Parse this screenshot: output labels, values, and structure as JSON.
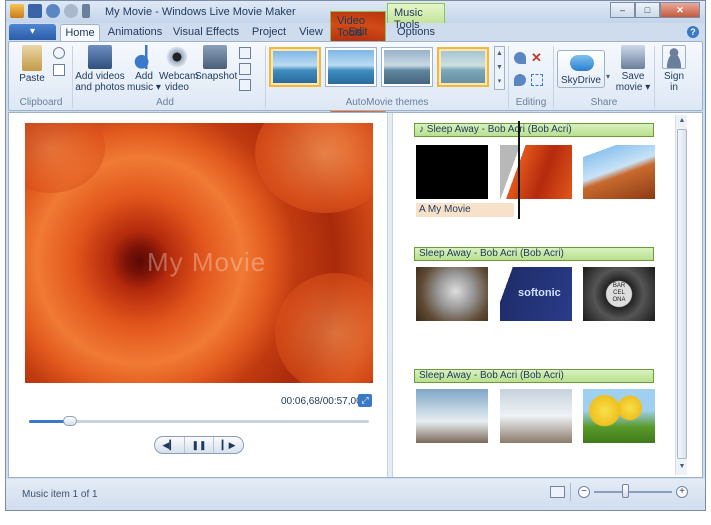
{
  "window": {
    "title": "My Movie - Windows Live Movie Maker",
    "context_tabs": {
      "video": "Video Tools",
      "music": "Music Tools"
    },
    "controls": {
      "minimize": "–",
      "maximize": "□",
      "close": "✕"
    }
  },
  "ribbon_tabs": [
    {
      "label": "Home"
    },
    {
      "label": "Animations"
    },
    {
      "label": "Visual Effects"
    },
    {
      "label": "Project"
    },
    {
      "label": "View"
    },
    {
      "label": "Edit"
    },
    {
      "label": "Options"
    }
  ],
  "file_button": "▾",
  "help": "?",
  "ribbon": {
    "clipboard": {
      "paste": "Paste",
      "label": "Clipboard"
    },
    "add": {
      "add_videos_line1": "Add videos",
      "add_videos_line2": "and photos",
      "add_music_line1": "Add",
      "add_music_line2": "music ▾",
      "webcam_line1": "Webcam",
      "webcam_line2": "video",
      "snapshot": "Snapshot",
      "label": "Add"
    },
    "themes_label": "AutoMovie themes",
    "editing_label": "Editing",
    "share": {
      "skydrive": "SkyDrive",
      "save_line1": "Save",
      "save_line2": "movie ▾",
      "label": "Share"
    },
    "sign_in_line1": "Sign",
    "sign_in_line2": "in"
  },
  "preview": {
    "watermark": "My Movie",
    "timecode": "00:06,68/00:57,00",
    "seek_progress": 0.12,
    "controls": {
      "prev": "◀▎",
      "play": "❚❚",
      "next": "▎▶"
    }
  },
  "storyboard": {
    "music_tracks": [
      "♪ Sleep Away - Bob Acri (Bob Acri)",
      "Sleep Away - Bob Acri (Bob Acri)",
      "Sleep Away - Bob Acri (Bob Acri)"
    ],
    "caption": "A My Movie",
    "softonic_text": "softonic",
    "sign_text": "BAR CEL ONA"
  },
  "status": {
    "text": "Music item 1 of 1",
    "zoom_minus": "−",
    "zoom_plus": "+",
    "zoom_level": 0.4
  },
  "colors": {
    "accent": "#3a78c8",
    "music_bar": "#b9e08f",
    "caption": "#f8e1c9",
    "theme_selected": "#f0b840"
  }
}
